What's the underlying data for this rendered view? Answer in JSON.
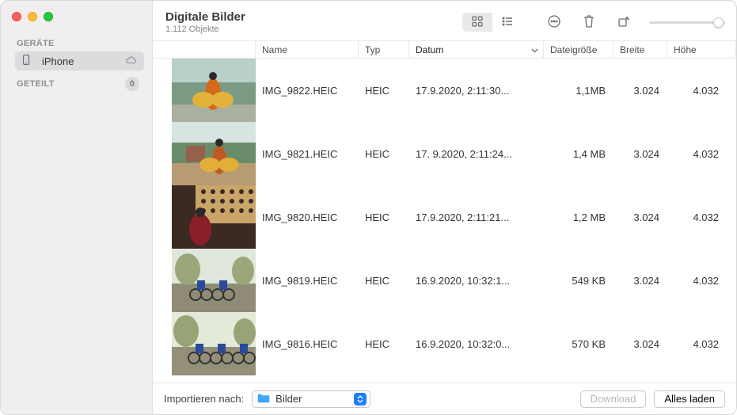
{
  "header": {
    "title": "Digitale Bilder",
    "subtitle": "1.112 Objekte"
  },
  "sidebar": {
    "sections": [
      {
        "label": "GERÄTE",
        "badge": null,
        "items": [
          {
            "label": "iPhone",
            "selected": true,
            "cloud": true
          }
        ]
      },
      {
        "label": "GETEILT",
        "badge": "0",
        "items": []
      }
    ]
  },
  "columns": {
    "name": "Name",
    "typ": "Typ",
    "datum": "Datum",
    "size": "Dateigröße",
    "breite": "Breite",
    "hoehe": "Höhe"
  },
  "rows": [
    {
      "name": "IMG_9822.HEIC",
      "typ": "HEIC",
      "date": "17.9.2020, 2:11:30...",
      "size": "1,1MB",
      "w": "3.024",
      "h": "4.032"
    },
    {
      "name": "IMG_9821.HEIC",
      "typ": "HEIC",
      "date": "17. 9.2020, 2:11:24...",
      "size": "1,4 MB",
      "w": "3.024",
      "h": "4.032"
    },
    {
      "name": "IMG_9820.HEIC",
      "typ": "HEIC",
      "date": "17.9.2020, 2:11:21...",
      "size": "1,2 MB",
      "w": "3.024",
      "h": "4.032"
    },
    {
      "name": "IMG_9819.HEIC",
      "typ": "HEIC",
      "date": "16.9.2020, 10:32:1...",
      "size": "549 KB",
      "w": "3.024",
      "h": "4.032"
    },
    {
      "name": "IMG_9816.HEIC",
      "typ": "HEIC",
      "date": "16.9.2020, 10:32:0...",
      "size": "570 KB",
      "w": "3.024",
      "h": "4.032"
    }
  ],
  "footer": {
    "import_label": "Importieren nach:",
    "destination": "Bilder",
    "download_label": "Download",
    "import_all_label": "Alles laden"
  }
}
